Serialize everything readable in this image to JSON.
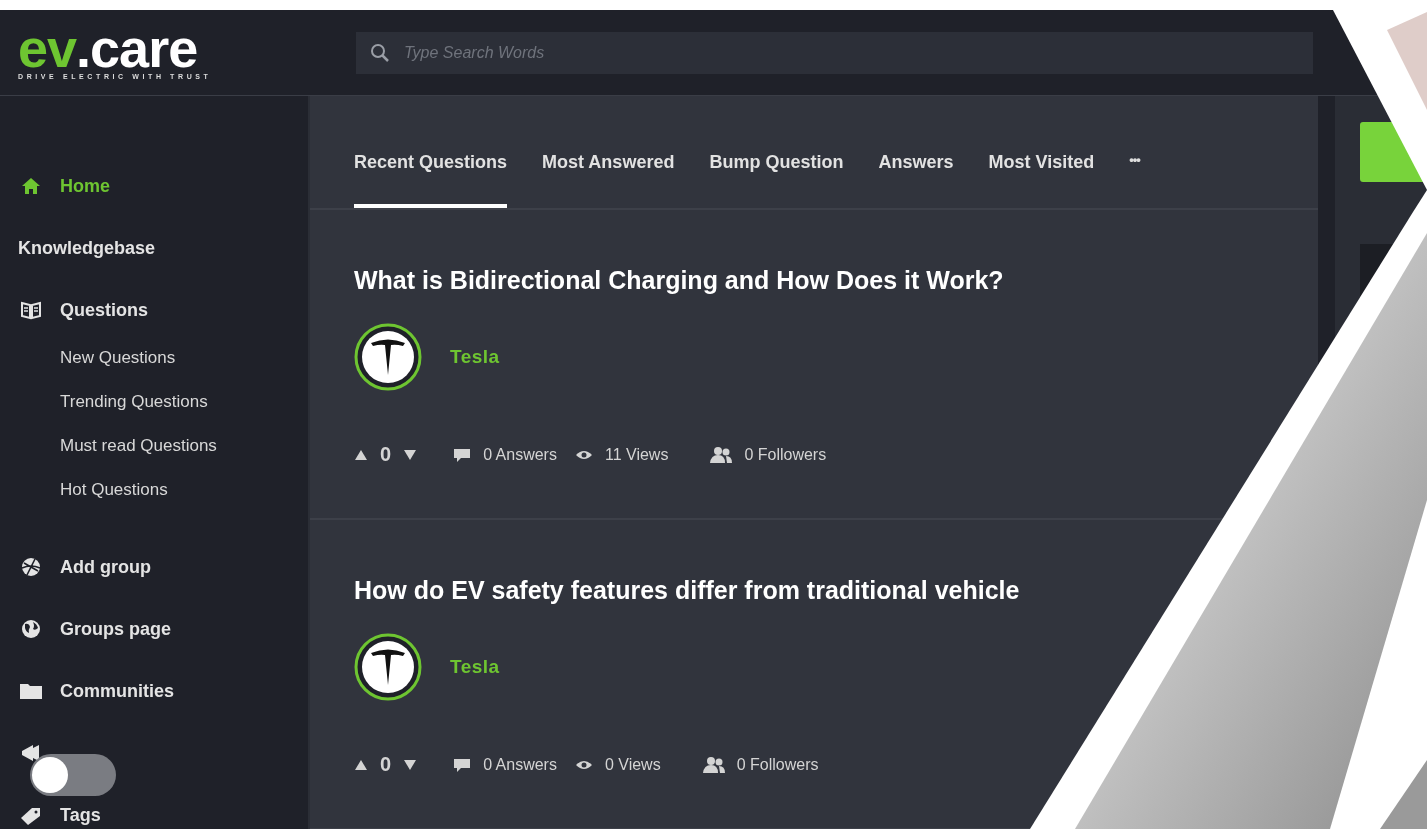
{
  "logo": {
    "accent": "ev",
    "rest": ".care",
    "tagline": "DRIVE ELECTRIC WITH TRUST"
  },
  "search": {
    "placeholder": "Type Search Words"
  },
  "sidebar": {
    "items": [
      {
        "kind": "home",
        "label": "Home",
        "selected": true
      },
      {
        "kind": "heading",
        "label": "Knowledgebase",
        "selected": false
      },
      {
        "kind": "questions",
        "label": "Questions",
        "selected": false,
        "children": [
          {
            "label": "New Questions",
            "selected": false
          },
          {
            "label": "Trending Questions",
            "selected": false
          },
          {
            "label": "Must read Questions",
            "selected": false
          },
          {
            "label": "Hot Questions",
            "selected": false
          }
        ]
      },
      {
        "kind": "add-group",
        "label": "Add group",
        "selected": false
      },
      {
        "kind": "groups",
        "label": "Groups page",
        "selected": false
      },
      {
        "kind": "communities",
        "label": "Communities",
        "selected": false
      },
      {
        "kind": "polls",
        "selected": false
      },
      {
        "kind": "tags",
        "label": "Tags",
        "selected": false
      }
    ]
  },
  "dark_mode_toggle": {
    "on": false
  },
  "tabs": [
    {
      "label": "Recent Questions",
      "selected": true
    },
    {
      "label": "Most Answered",
      "selected": false
    },
    {
      "label": "Bump Question",
      "selected": false
    },
    {
      "label": "Answers",
      "selected": false
    },
    {
      "label": "Most Visited",
      "selected": false
    }
  ],
  "more_label": "•••",
  "questions": [
    {
      "title": "What is Bidirectional Charging and How Does it Work?",
      "author": "Tesla",
      "votes": "0",
      "answers": "0 Answers",
      "views": "11 Views",
      "followers": "0 Followers"
    },
    {
      "title": "How do EV safety features differ from traditional vehicle",
      "author": "Tesla",
      "votes": "0",
      "answers": "0 Answers",
      "views": "0 Views",
      "followers": "0 Followers"
    }
  ]
}
